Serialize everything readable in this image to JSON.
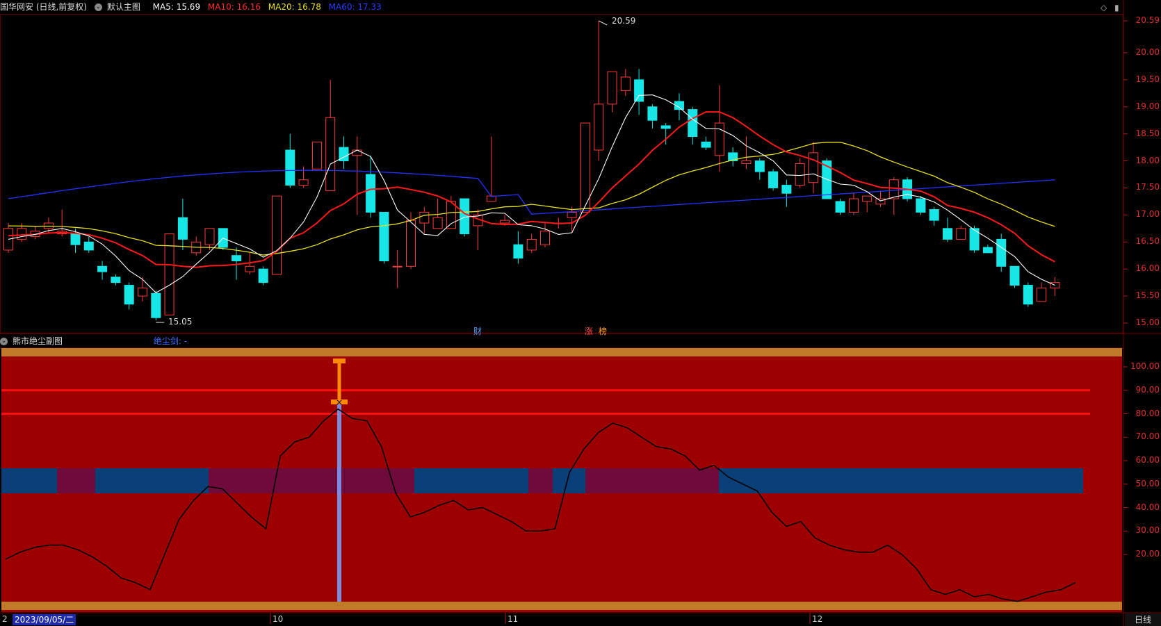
{
  "main_header": {
    "stock_title": "国华网安 (日线,前复权)",
    "chart_selector": "默认主图",
    "ma5": "MA5: 15.69",
    "ma10": "MA10: 16.16",
    "ma20": "MA20: 16.78",
    "ma60": "MA60: 17.33"
  },
  "sub_header": {
    "title": "熊市绝尘副图",
    "indicator": "绝尘剑: -"
  },
  "price_axis": [
    "20.59",
    "20.00",
    "19.50",
    "19.00",
    "18.50",
    "18.00",
    "17.50",
    "17.00",
    "16.50",
    "16.00",
    "15.50",
    "15.00"
  ],
  "osc_axis": [
    "100.00",
    "90.00",
    "80.00",
    "70.00",
    "60.00",
    "50.00",
    "40.00",
    "30.00",
    "20.00"
  ],
  "markers": {
    "high": "20.59",
    "low": "15.05",
    "tag_cai": "财",
    "tag_zhang": "涨",
    "tag_bang": "榜"
  },
  "x_axis": {
    "start_prefix": "2",
    "date_badge": "2023/09/05/二",
    "months": [
      "10",
      "11",
      "12"
    ]
  },
  "period_label": "日线",
  "colors": {
    "up": "#ff3b3b",
    "down": "#16e6e6",
    "ma5": "#ffffff",
    "ma10": "#ff1a1a",
    "ma20": "#e8e020",
    "ma60": "#2233ff",
    "osc_bg": "#9c0000",
    "band_orange": "#c07a28"
  },
  "chart_data": {
    "type": "candlestick",
    "series": [
      {
        "name": "MA5"
      },
      {
        "name": "MA10"
      },
      {
        "name": "MA20"
      },
      {
        "name": "MA60"
      }
    ],
    "ohlc": [
      [
        16.35,
        16.75,
        16.85,
        16.3
      ],
      [
        16.55,
        16.75,
        16.85,
        16.5
      ],
      [
        16.6,
        16.7,
        16.8,
        16.55
      ],
      [
        16.75,
        16.85,
        16.95,
        16.65
      ],
      [
        16.65,
        16.7,
        17.1,
        16.6
      ],
      [
        16.65,
        16.45,
        16.75,
        16.3
      ],
      [
        16.5,
        16.35,
        16.6,
        16.3
      ],
      [
        16.05,
        15.95,
        16.15,
        15.8
      ],
      [
        15.85,
        15.75,
        15.9,
        15.7
      ],
      [
        15.7,
        15.35,
        15.75,
        15.25
      ],
      [
        15.5,
        15.65,
        15.85,
        15.4
      ],
      [
        15.55,
        15.1,
        15.6,
        15.05
      ],
      [
        15.15,
        16.65,
        16.65,
        15.15
      ],
      [
        16.95,
        16.55,
        17.3,
        16.35
      ],
      [
        16.3,
        16.5,
        16.6,
        16.25
      ],
      [
        16.45,
        16.75,
        16.75,
        16.35
      ],
      [
        16.75,
        16.4,
        16.75,
        16.35
      ],
      [
        16.25,
        16.15,
        16.4,
        15.8
      ],
      [
        15.95,
        16.05,
        16.3,
        15.9
      ],
      [
        16.0,
        15.75,
        16.05,
        15.7
      ],
      [
        15.9,
        17.35,
        17.35,
        15.9
      ],
      [
        18.2,
        17.55,
        18.5,
        17.5
      ],
      [
        17.55,
        17.65,
        17.9,
        17.5
      ],
      [
        17.85,
        18.35,
        18.35,
        17.85
      ],
      [
        17.45,
        18.8,
        19.5,
        17.45
      ],
      [
        18.25,
        18.0,
        18.45,
        17.85
      ],
      [
        18.1,
        18.2,
        18.45,
        17.0
      ],
      [
        17.75,
        17.05,
        18.1,
        16.95
      ],
      [
        17.05,
        16.15,
        17.05,
        16.1
      ],
      [
        16.05,
        16.05,
        16.35,
        15.65
      ],
      [
        16.05,
        16.9,
        17.05,
        16.0
      ],
      [
        16.85,
        17.05,
        17.15,
        16.65
      ],
      [
        16.75,
        16.95,
        17.3,
        16.75
      ],
      [
        16.75,
        17.25,
        17.35,
        16.75
      ],
      [
        17.3,
        16.65,
        17.3,
        16.6
      ],
      [
        16.8,
        17.0,
        17.1,
        16.35
      ],
      [
        17.25,
        17.35,
        18.45,
        17.25
      ],
      [
        16.85,
        16.9,
        17.0,
        16.8
      ],
      [
        16.45,
        16.2,
        16.7,
        16.1
      ],
      [
        16.35,
        16.55,
        16.65,
        16.3
      ],
      [
        16.45,
        16.7,
        16.85,
        16.4
      ],
      [
        16.85,
        16.85,
        16.95,
        16.75
      ],
      [
        16.95,
        17.05,
        17.15,
        16.7
      ],
      [
        17.05,
        18.7,
        18.7,
        17.05
      ],
      [
        18.2,
        19.05,
        20.59,
        18.0
      ],
      [
        19.05,
        19.65,
        19.65,
        18.9
      ],
      [
        19.3,
        19.55,
        19.7,
        19.2
      ],
      [
        19.5,
        19.1,
        19.7,
        18.85
      ],
      [
        19.0,
        18.75,
        19.05,
        18.6
      ],
      [
        18.65,
        18.6,
        18.7,
        18.3
      ],
      [
        19.1,
        18.95,
        19.25,
        18.75
      ],
      [
        18.95,
        18.45,
        19.0,
        18.3
      ],
      [
        18.35,
        18.25,
        18.45,
        18.2
      ],
      [
        18.1,
        18.7,
        19.4,
        17.8
      ],
      [
        18.15,
        18.0,
        18.25,
        17.9
      ],
      [
        17.95,
        18.0,
        18.45,
        17.85
      ],
      [
        18.0,
        17.8,
        18.05,
        17.65
      ],
      [
        17.8,
        17.5,
        17.85,
        17.45
      ],
      [
        17.55,
        17.4,
        17.65,
        17.15
      ],
      [
        17.55,
        17.95,
        18.05,
        17.5
      ],
      [
        17.6,
        18.15,
        18.35,
        17.4
      ],
      [
        18.0,
        17.3,
        18.05,
        17.3
      ],
      [
        17.25,
        17.05,
        17.3,
        17.0
      ],
      [
        17.05,
        17.3,
        17.4,
        17.0
      ],
      [
        17.25,
        17.35,
        17.3,
        17.05
      ],
      [
        17.2,
        17.3,
        17.45,
        17.15
      ],
      [
        17.3,
        17.65,
        17.7,
        17.0
      ],
      [
        17.65,
        17.3,
        17.7,
        17.25
      ],
      [
        17.3,
        17.05,
        17.35,
        17.0
      ],
      [
        17.1,
        16.9,
        17.15,
        16.8
      ],
      [
        16.75,
        16.55,
        16.95,
        16.5
      ],
      [
        16.55,
        16.75,
        16.8,
        16.55
      ],
      [
        16.75,
        16.35,
        16.8,
        16.3
      ],
      [
        16.4,
        16.3,
        16.45,
        16.3
      ],
      [
        16.55,
        16.05,
        16.65,
        15.95
      ],
      [
        16.05,
        15.7,
        16.05,
        15.65
      ],
      [
        15.7,
        15.35,
        15.75,
        15.3
      ],
      [
        15.4,
        15.65,
        15.75,
        15.4
      ],
      [
        15.65,
        15.75,
        15.85,
        15.5
      ]
    ],
    "price_ylim": [
      14.95,
      20.8
    ],
    "oscillator": {
      "name": "熊市绝尘副图",
      "ylim": [
        0,
        100
      ],
      "lines": [
        80,
        90
      ],
      "values": [
        18,
        21,
        23,
        24,
        24,
        22,
        19,
        15,
        10,
        8,
        5,
        20,
        35,
        43,
        49,
        48,
        42,
        36,
        31,
        62,
        68,
        70,
        77,
        82,
        78,
        77,
        66,
        46,
        36,
        38,
        41,
        43,
        39,
        40,
        37,
        34,
        30,
        30,
        31,
        55,
        65,
        72,
        76,
        74,
        70,
        66,
        65,
        62,
        56,
        58,
        53,
        50,
        47,
        38,
        32,
        34,
        27,
        24,
        22,
        21,
        21,
        24,
        20,
        14,
        5,
        3,
        5,
        2,
        3,
        1,
        0,
        2,
        4,
        5,
        8
      ]
    }
  }
}
